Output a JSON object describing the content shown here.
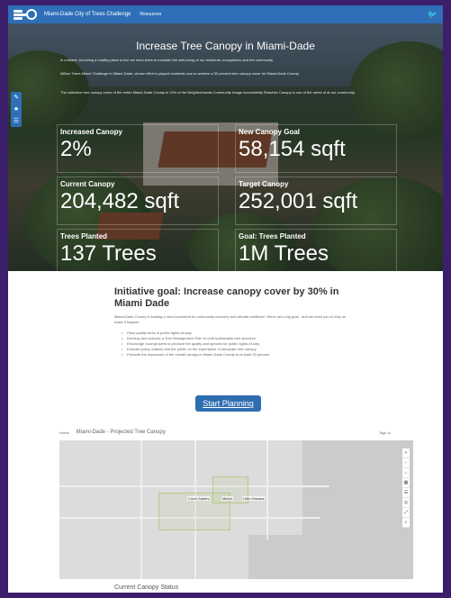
{
  "header": {
    "title": "Miami-Dade City of Trees Challenge",
    "nav_item": "Resources",
    "social_icon": "twitter-icon",
    "colors": {
      "bar": "#2e6fb8",
      "outer": "#3b1f6b"
    }
  },
  "side_tools": [
    "pencil-icon",
    "star-icon",
    "list-icon"
  ],
  "hero": {
    "title": "Increase Tree Canopy in Miami-Dade",
    "paragraphs": [
      "In a Miami, Da-being a healthy place to live we need trees to maintain the well-being of our residents, ecosystems and the community",
      "Million Trees Miami Challenge in Miami-Dade, whose effort is played residents now to achieve a 30 percent tree canopy cover for Miami-Dade County.",
      "The collective tree canopy cover of the entire Miami-Dade County is 13% of the Neighborhoods Community Image Accessibility Reaches Canopy is one of the areas of at our community."
    ]
  },
  "metrics": [
    {
      "label": "Increased Canopy",
      "value": "2%"
    },
    {
      "label": "New Canopy Goal",
      "value": "58,154 sqft"
    },
    {
      "label": "Current Canopy",
      "value": "204,482 sqft"
    },
    {
      "label": "Target Canopy",
      "value": "252,001 sqft"
    },
    {
      "label": "Trees Planted",
      "value": "137 Trees"
    },
    {
      "label": "Goal: Trees Planted",
      "value": "1M Trees"
    }
  ],
  "initiative": {
    "title": "Initiative goal: Increase canopy cover by 30% in Miami Dade",
    "intro": "Miami-Dade County is leading a new movement for community recovery and climate resilience. We're set a big goal - and we need you to help us make it happen.",
    "bullets": [
      "Plant quality trees in public rights-of-way",
      "Develop and execute a Tree Management Plan to craft sustainable tree structure",
      "Encourage local growers to produce the quality and species for public rights-of-way",
      "Educate policy makers and the public on the importance of adequate tree canopy",
      "Promote the expansion of the overall canopy in Miami-Dade County to at least 30 percent"
    ]
  },
  "cta": {
    "label": "Start Planning"
  },
  "map": {
    "home_label": "Home",
    "title": "Miami-Dade - Projected Tree Canopy",
    "sign_in": "Sign In",
    "tools": [
      "+",
      "−",
      "⌂",
      "▦",
      "☰",
      "◎",
      "⤢",
      "⌕"
    ],
    "labels": [
      "Coral Gables",
      "Miami",
      "Little Havana"
    ]
  },
  "footer_heading": "Current Canopy Status"
}
